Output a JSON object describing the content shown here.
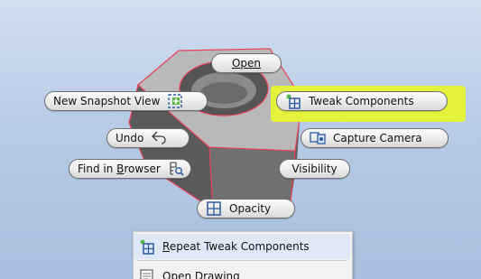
{
  "marking_menu": {
    "open": "Open",
    "new_snapshot_view": "New Snapshot View",
    "tweak_components": "Tweak Components",
    "undo": "Undo",
    "capture_camera": "Capture Camera",
    "find_in_browser_prefix": "Find in ",
    "find_in_browser_underlined": "B",
    "find_in_browser_suffix": "rowser",
    "visibility": "Visibility",
    "opacity": "Opacity"
  },
  "context_menu": {
    "items": [
      {
        "underlined": "R",
        "rest": "epeat Tweak Components"
      },
      {
        "underlined": "",
        "rest": "Open Drawing"
      }
    ]
  },
  "highlight_color": "#e4f23c",
  "colors": {
    "viewport_top": "#d2def0",
    "viewport_bottom": "#a8bfe0",
    "part_edge": "#e8445a",
    "pill_border": "#6f6f6f"
  },
  "icons": [
    "snapshot-icon",
    "tweak-icon",
    "undo-arrow-icon",
    "capture-camera-icon",
    "find-browser-icon",
    "opacity-icon",
    "tweak-small-icon",
    "drawing-icon"
  ]
}
